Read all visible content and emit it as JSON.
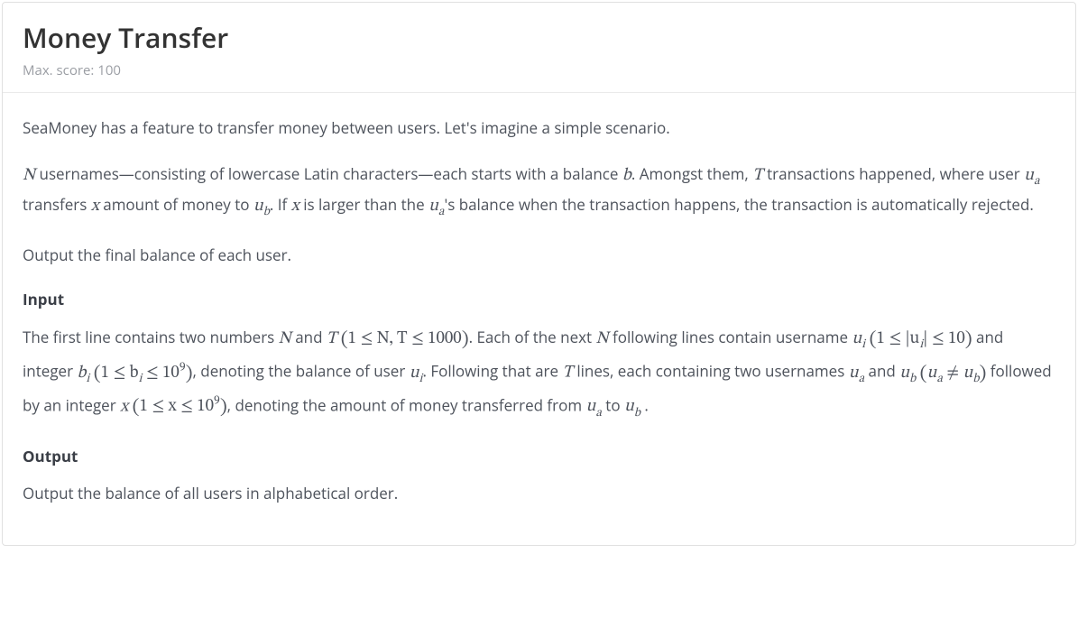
{
  "header": {
    "title": "Money Transfer",
    "max_score_label": "Max. score: 100"
  },
  "content": {
    "intro": "SeaMoney has a feature to transfer money between users. Let's imagine a simple scenario.",
    "p2_1": " usernames—consisting of lowercase Latin characters—each starts with a balance ",
    "p2_2": ". Amongst them, ",
    "p2_3": " transactions happened, where user ",
    "p2_4": " transfers ",
    "p2_5": " amount of money to ",
    "p2_6": ". If ",
    "p2_7": " is larger than the ",
    "p2_8": "'s balance when the transaction happens, the transaction is automatically rejected.",
    "output_task": "Output the final balance of each user.",
    "input_heading": "Input",
    "in_1": "The first line contains two numbers ",
    "in_2": " and ",
    "in_3": ". Each of the next ",
    "in_4": " following lines contain username ",
    "in_5": " and integer ",
    "in_6": ", denoting the balance of user ",
    "in_7": ". Following that are ",
    "in_8": " lines, each containing two usernames ",
    "in_9": " and ",
    "in_10": " followed by an integer ",
    "in_11": ", denoting the amount of money transferred from ",
    "in_12": " to ",
    "in_13": " .",
    "output_heading": "Output",
    "output_body": "Output the balance of all users in alphabetical order.",
    "math": {
      "N": "N",
      "T": "T",
      "b": "b",
      "x": "x",
      "u": "u",
      "ua": "a",
      "ub": "b",
      "ui": "i",
      "bi": "b",
      "nt_constraint_open": "(",
      "nt_constraint_body": "1 ≤ N, T ≤ 1000",
      "nt_constraint_close": ")",
      "ui_constraint_open": "(",
      "ui_constraint_body1": "1 ≤ |u",
      "ui_constraint_body2": "| ≤ 10",
      "ui_constraint_close": ")",
      "bi_constraint_open": "(",
      "bi_constraint_body1": "1 ≤ b",
      "bi_constraint_body2": " ≤ 10",
      "bi_constraint_exp": "9",
      "bi_constraint_close": ")",
      "uaub_open": "(",
      "uaub_ne": " ≠ ",
      "uaub_close": ")",
      "x_constraint_open": "(",
      "x_constraint_body1": "1 ≤ x ≤ 10",
      "x_constraint_exp": "9",
      "x_constraint_close": ")"
    }
  }
}
